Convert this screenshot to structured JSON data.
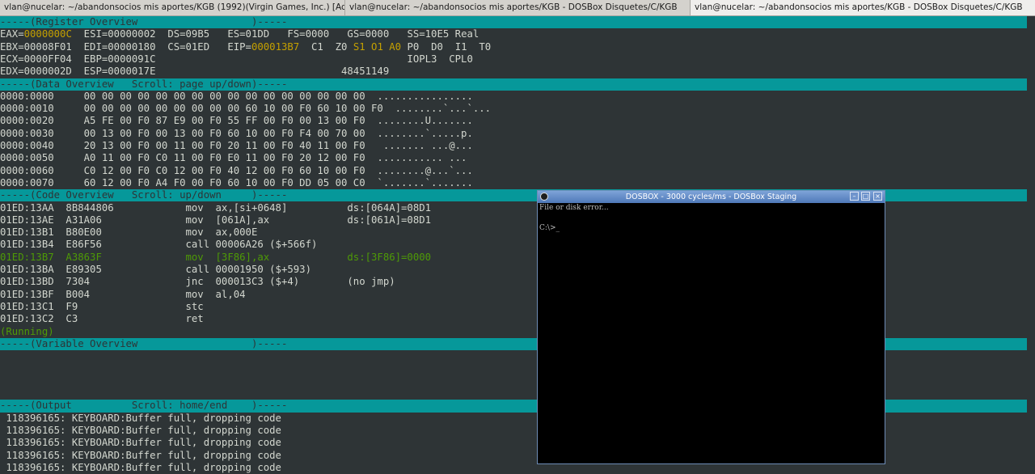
{
  "tabs": [
    "vlan@nucelar: ~/abandonsocios mis aportes/KGB (1992)(Virgin Games, Inc.) [Adventure]",
    "vlan@nucelar: ~/abandonsocios mis aportes/KGB - DOSBox Disquetes/C/KGB",
    "vlan@nucelar: ~/abandonsocios mis aportes/KGB - DOSBox Disquetes/C/KGB"
  ],
  "register": {
    "header": "-----(Register Overview                   )-----",
    "r1": {
      "pre": "EAX=",
      "eax": "0000000C",
      "post": "  ESI=00000002  DS=09B5   ES=01DD   FS=0000   GS=0000   SS=10E5 Real"
    },
    "r2": {
      "pre": "EBX=00008F01  EDI=00000180  CS=01ED   EIP=",
      "eip": "000013B7",
      "mid": "  C1  Z0 ",
      "s1": "S1",
      "gap": " ",
      "o1": "O1",
      "gap2": " ",
      "a0": "A0",
      "rest": " P0  D0  I1  T0"
    },
    "r3": "ECX=0000FF04  EBP=0000091C                                          IOPL3  CPL0",
    "r4": "EDX=0000002D  ESP=0000017E                               48451149"
  },
  "data_overview": {
    "header": "-----(Data Overview   Scroll: page up/down)-----",
    "rows": [
      "0000:0000     00 00 00 00 00 00 00 00 00 00 00 00 00 00 00 00  ................",
      "0000:0010     00 00 00 00 00 00 00 00 00 60 10 00 F0 60 10 00 F0  ........`...`...",
      "0000:0020     A5 FE 00 F0 87 E9 00 F0 55 FF 00 F0 00 13 00 F0  ........U.......",
      "0000:0030     00 13 00 F0 00 13 00 F0 60 10 00 F0 F4 00 70 00  ........`.....p.",
      "0000:0040     20 13 00 F0 00 11 00 F0 20 11 00 F0 40 11 00 F0   ....... ...@...",
      "0000:0050     A0 11 00 F0 C0 11 00 F0 E0 11 00 F0 20 12 00 F0  ........... ...",
      "0000:0060     C0 12 00 F0 C0 12 00 F0 40 12 00 F0 60 10 00 F0  ........@...`...",
      "0000:0070     60 12 00 F0 A4 F0 00 F0 60 10 00 F0 DD 05 00 C0  `.......`......."
    ]
  },
  "code_overview": {
    "header": "-----(Code Overview   Scroll: up/down     )-----",
    "rows": [
      "01ED:13AA  8B844806            mov  ax,[si+0648]          ds:[064A]=08D1",
      "01ED:13AE  A31A06              mov  [061A],ax             ds:[061A]=08D1",
      "01ED:13B1  B80E00              mov  ax,000E",
      "01ED:13B4  E86F56              call 00006A26 ($+566f)",
      "01ED:13B7  A3863F              mov  [3F86],ax             ds:[3F86]=0000",
      "01ED:13BA  E89305              call 00001950 ($+593)",
      "01ED:13BD  7304                jnc  000013C3 ($+4)        (no jmp)",
      "01ED:13BF  B004                mov  al,04",
      "01ED:13C1  F9                  stc",
      "01ED:13C2  C3                  ret"
    ],
    "status": "(Running)"
  },
  "variable_overview": {
    "header": "-----(Variable Overview                   )-----"
  },
  "output": {
    "header": "-----(Output          Scroll: home/end    )-----",
    "rows": [
      " 118396165: KEYBOARD:Buffer full, dropping code",
      " 118396165: KEYBOARD:Buffer full, dropping code",
      " 118396165: KEYBOARD:Buffer full, dropping code",
      " 118396165: KEYBOARD:Buffer full, dropping code",
      " 118396165: KEYBOARD:Buffer full, dropping code"
    ]
  },
  "dosbox": {
    "title": "DOSBOX - 3000 cycles/ms - DOSBox Staging",
    "line1": "File or disk error...",
    "prompt": "C:\\>_"
  },
  "colors": {
    "band": "#06989a",
    "bg": "#2e3436",
    "fg": "#d3d7cf",
    "highlight": "#c4a000",
    "current": "#4e9a06"
  }
}
